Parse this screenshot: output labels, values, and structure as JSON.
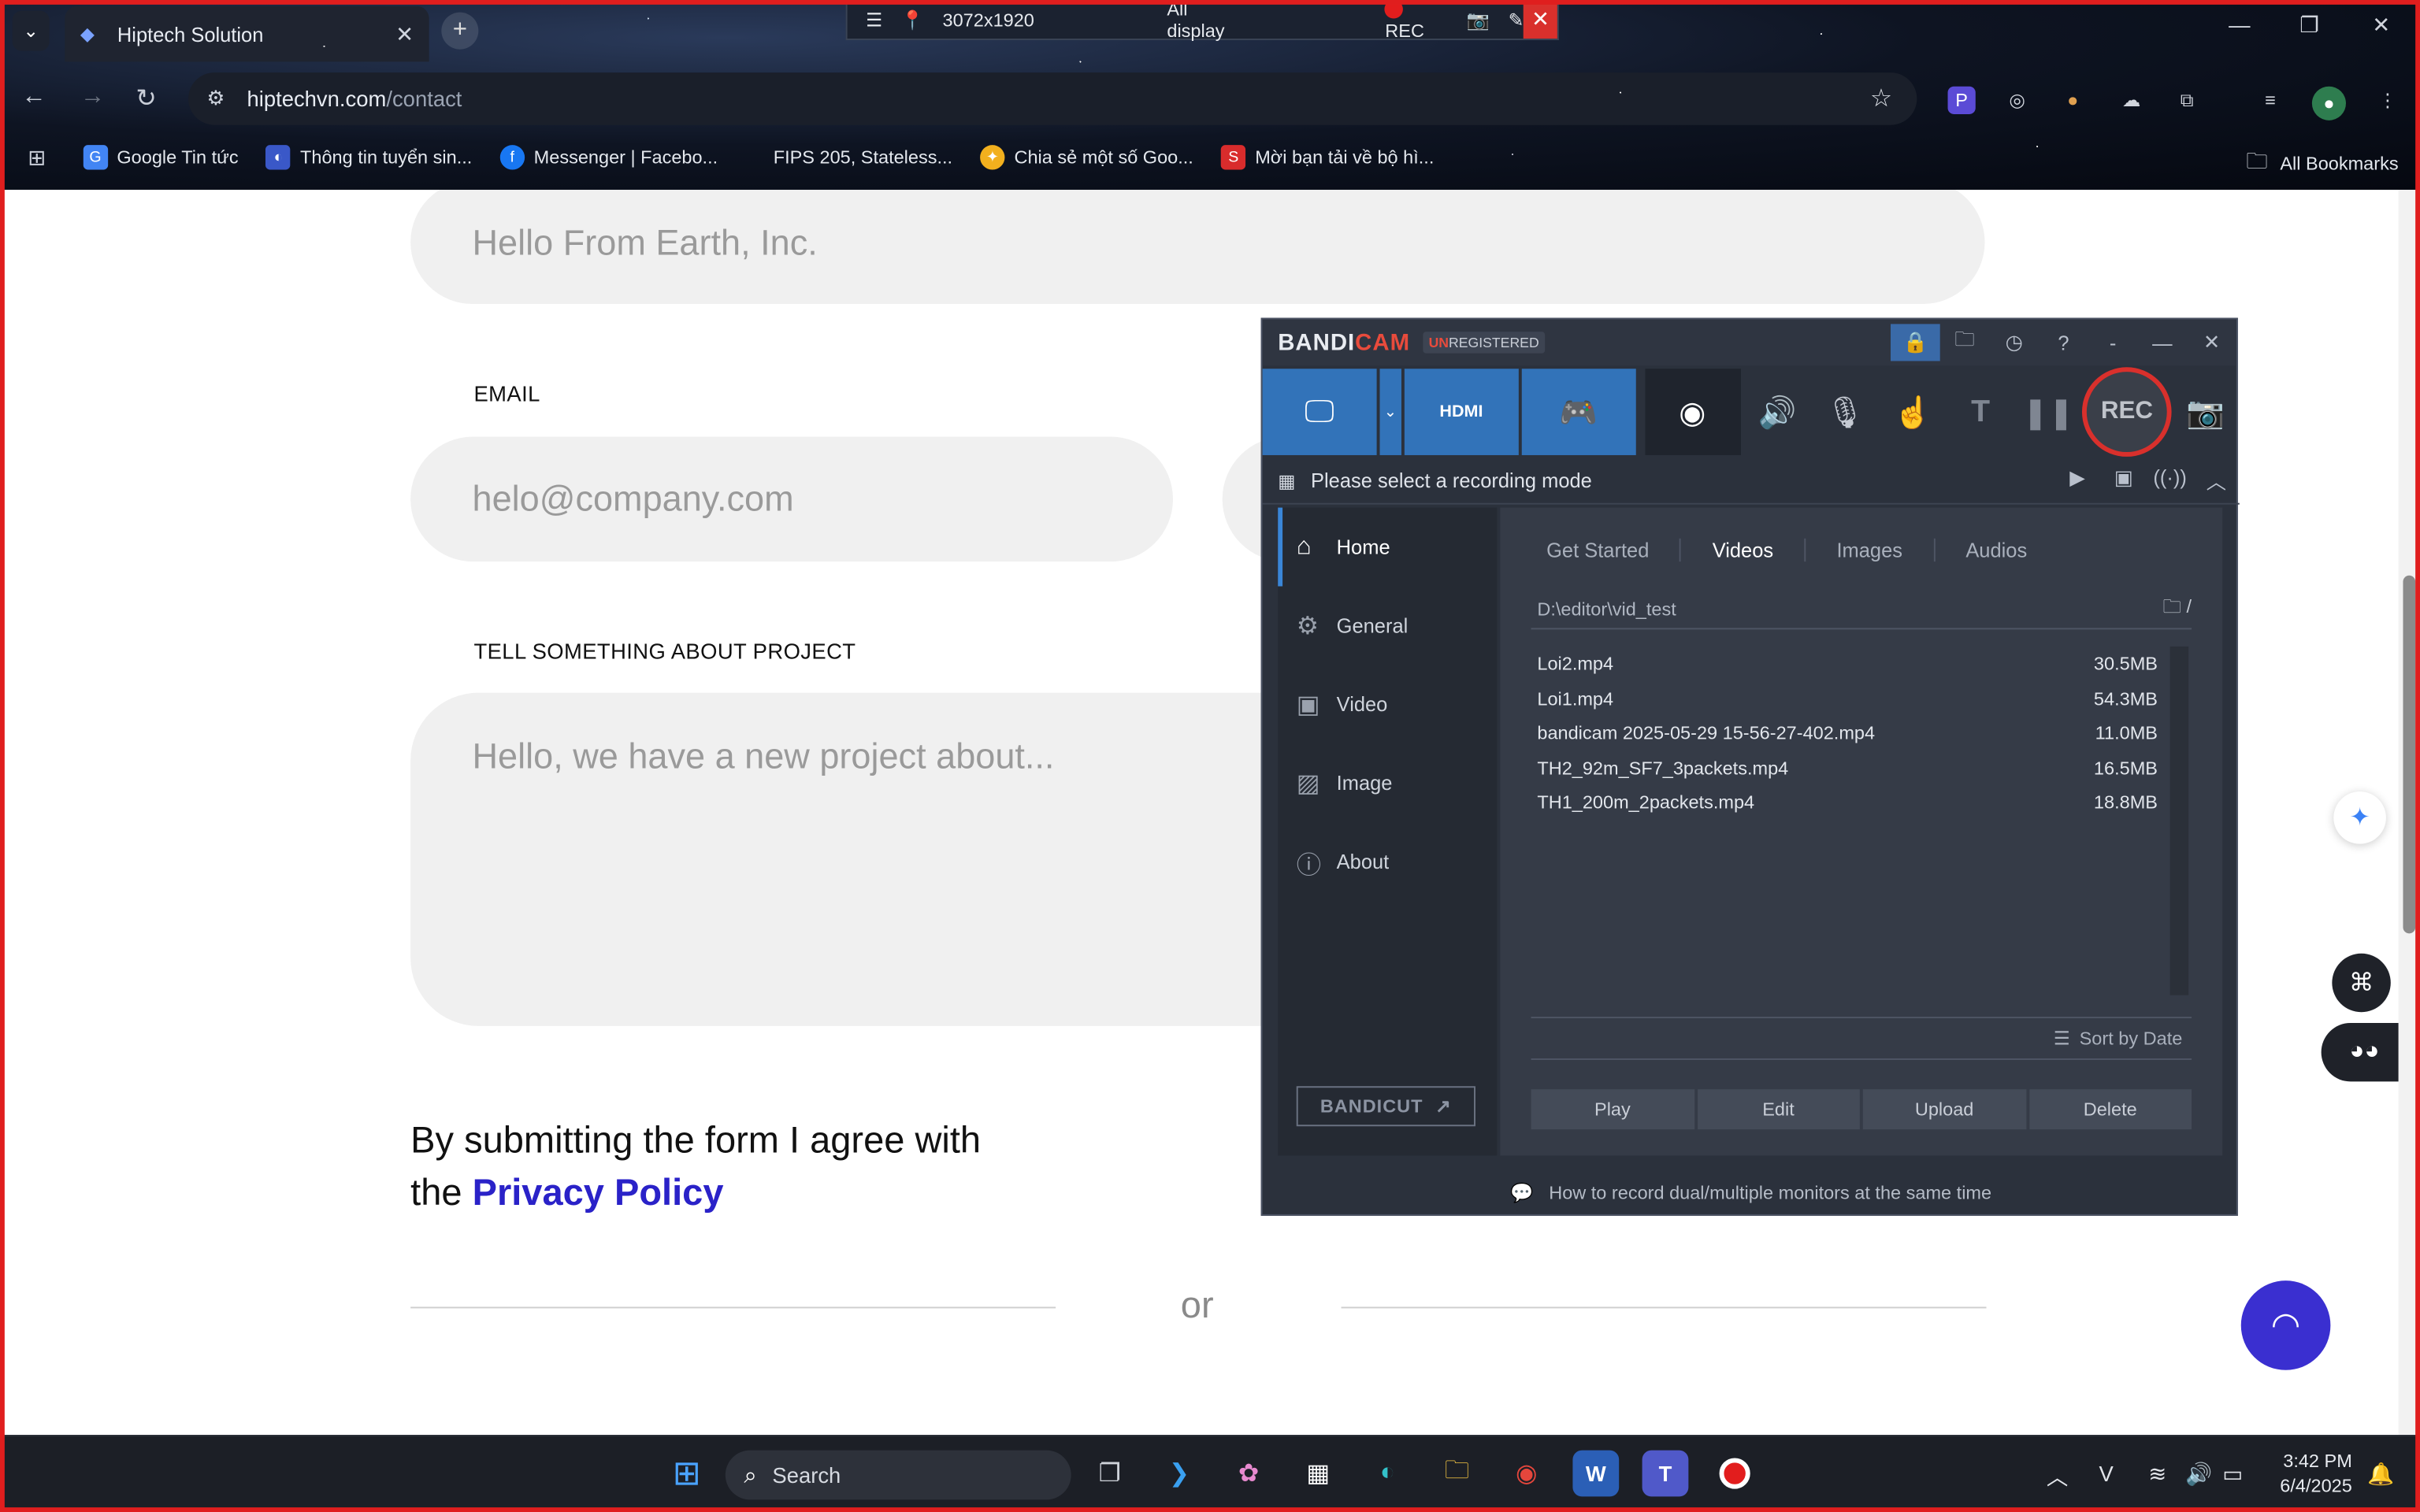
{
  "browser": {
    "tab_title": "Hiptech Solution",
    "url_host": "hiptechvn.com",
    "url_path": "/contact",
    "bookmarks": [
      {
        "label": "Google Tin tức",
        "icon": "google-news-icon",
        "color": "#4285f4"
      },
      {
        "label": "Thông tin tuyển sin...",
        "icon": "university-icon",
        "color": "#3a58c8"
      },
      {
        "label": "Messenger | Facebo...",
        "icon": "facebook-icon",
        "color": "#1877f2"
      },
      {
        "label": "FIPS 205, Stateless...",
        "icon": "",
        "color": ""
      },
      {
        "label": "Chia sẻ một số Goo...",
        "icon": "bulb-icon",
        "color": "#f2b01e"
      },
      {
        "label": "Mời bạn tải về bộ hì...",
        "icon": "s-icon",
        "color": "#d92c2c"
      }
    ],
    "all_bookmarks": "All Bookmarks"
  },
  "recorder_bar": {
    "resolution": "3072x1920",
    "display": "All display",
    "rec": "REC"
  },
  "page": {
    "company_value": "Hello From Earth, Inc.",
    "email_label": "EMAIL",
    "email_placeholder": "helo@company.com",
    "project_label": "TELL SOMETHING ABOUT PROJECT",
    "project_placeholder": "Hello, we have a new project about...",
    "consent_line1": "By submitting the form I agree with",
    "consent_the": "the ",
    "consent_link": "Privacy Policy",
    "or": "or"
  },
  "bandicam": {
    "logo_a": "BANDI",
    "logo_b": "CAM",
    "unreg_a": "UN",
    "unreg_b": "REGISTERED",
    "status": "Please select a recording mode",
    "rec": "REC",
    "nav": [
      "Home",
      "General",
      "Video",
      "Image",
      "About"
    ],
    "tabs": [
      "Get Started",
      "Videos",
      "Images",
      "Audios"
    ],
    "active_tab": "Videos",
    "path": "D:\\editor\\vid_test",
    "files": [
      {
        "name": "Loi2.mp4",
        "size": "30.5MB"
      },
      {
        "name": "Loi1.mp4",
        "size": "54.3MB"
      },
      {
        "name": "bandicam 2025-05-29 15-56-27-402.mp4",
        "size": "11.0MB"
      },
      {
        "name": "TH2_92m_SF7_3packets.mp4",
        "size": "16.5MB"
      },
      {
        "name": "TH1_200m_2packets.mp4",
        "size": "18.8MB"
      }
    ],
    "sort": "Sort by Date",
    "actions": [
      "Play",
      "Edit",
      "Upload",
      "Delete"
    ],
    "bandicut": "BANDICUT",
    "footer_tip": "How to record dual/multiple monitors at the same time"
  },
  "taskbar": {
    "search": "Search",
    "time": "3:42 PM",
    "date": "6/4/2025"
  },
  "colors": {
    "accent_blue": "#3273b9",
    "rec_red": "#d9302c",
    "privacy_link": "#2a22c8",
    "chat_fab": "#3a2fd0"
  }
}
